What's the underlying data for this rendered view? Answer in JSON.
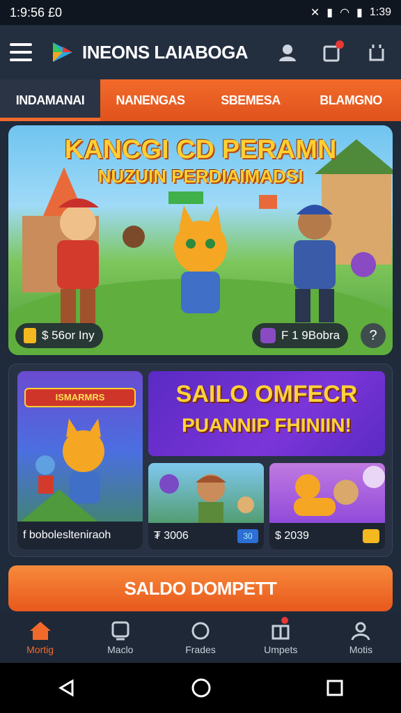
{
  "status": {
    "time": "1:9:56 £0",
    "battery_text": "1:39"
  },
  "app": {
    "title": "INEONS LAIABOGA"
  },
  "tabs": [
    {
      "label": "INDAMANAI",
      "active": true
    },
    {
      "label": "NANENGAS",
      "active": false
    },
    {
      "label": "SBEMESA",
      "active": false
    },
    {
      "label": "BLAMGNO",
      "active": false
    }
  ],
  "hero": {
    "title_line1": "KANCGI CD PERAMN",
    "title_line2": "NUZUIN PERDIAIMADSI",
    "left_pill": "$ 56or Iny",
    "right_pill": "F 1 9Bobra",
    "help": "?"
  },
  "promo": {
    "badge": "ISMARMRS",
    "banner_line1": "SAILO OMFECR",
    "banner_line2": "PUANNIP FHINIIN!",
    "main_caption": "f boboleslteniraoh",
    "card1_caption": "₮ 3006",
    "card1_badge": "30",
    "card2_caption": "$ 2039"
  },
  "cta": {
    "label": "SALDO DOMPETT"
  },
  "bottom_nav": [
    {
      "label": "Mortig",
      "icon": "home-icon",
      "active": true
    },
    {
      "label": "Maclo",
      "icon": "game-controller-icon",
      "active": false
    },
    {
      "label": "Frades",
      "icon": "refresh-icon",
      "active": false
    },
    {
      "label": "Umpets",
      "icon": "gift-icon",
      "active": false,
      "badge": true
    },
    {
      "label": "Motis",
      "icon": "profile-icon",
      "active": false
    }
  ],
  "colors": {
    "accent": "#f26a2b",
    "background": "#1f2a3a",
    "promo_purple": "#7b35d8"
  }
}
